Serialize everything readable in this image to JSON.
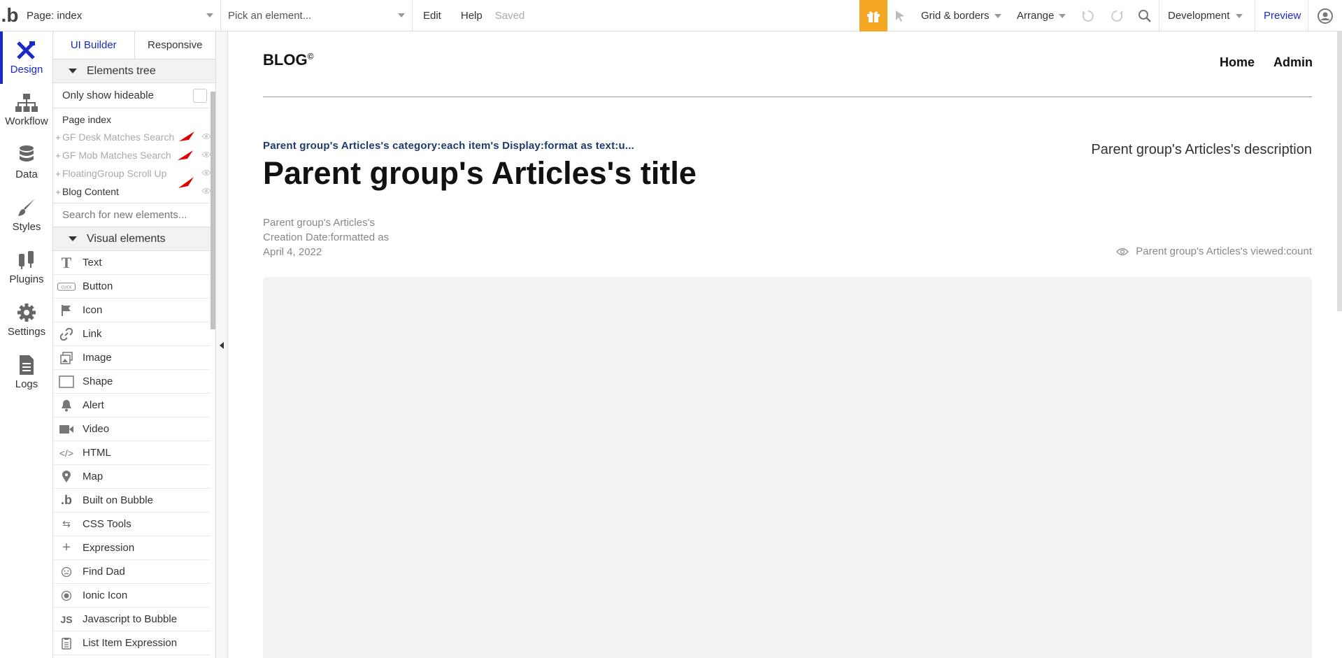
{
  "topbar": {
    "page_select": "Page: index",
    "element_picker": "Pick an element...",
    "edit": "Edit",
    "help": "Help",
    "saved": "Saved",
    "grid": "Grid & borders",
    "arrange": "Arrange",
    "environment": "Development",
    "preview": "Preview"
  },
  "rail": {
    "items": [
      {
        "label": "Design",
        "icon": "design-icon"
      },
      {
        "label": "Workflow",
        "icon": "workflow-icon"
      },
      {
        "label": "Data",
        "icon": "database-icon"
      },
      {
        "label": "Styles",
        "icon": "brush-icon"
      },
      {
        "label": "Plugins",
        "icon": "plug-icon"
      },
      {
        "label": "Settings",
        "icon": "gear-icon"
      },
      {
        "label": "Logs",
        "icon": "document-icon"
      }
    ]
  },
  "panel": {
    "tab_ui": "UI Builder",
    "tab_responsive": "Responsive",
    "elements_tree": "Elements tree",
    "only_show_hideable": "Only show hideable",
    "page_root": "Page index",
    "tree": [
      "GF Desk Matches Search",
      "GF Mob Matches Search",
      "FloatingGroup Scroll Up",
      "Blog Content"
    ],
    "search_placeholder": "Search for new elements...",
    "visual_elements": "Visual elements",
    "visual": [
      "Text",
      "Button",
      "Icon",
      "Link",
      "Image",
      "Shape",
      "Alert",
      "Video",
      "HTML",
      "Map",
      "Built on Bubble",
      "CSS Tools",
      "Expression",
      "Find Dad",
      "Ionic Icon",
      "Javascript to Bubble",
      "List Item Expression"
    ]
  },
  "canvas": {
    "logo": "BLOG",
    "logo_sup": "©",
    "nav_home": "Home",
    "nav_admin": "Admin",
    "category": "Parent group's Articles's category:each item's Display:format as text:u...",
    "title": "Parent group's Articles's title",
    "description": "Parent group's Articles's description",
    "date_line1": "Parent group's Articles's",
    "date_line2": "Creation Date:formatted as",
    "date_line3": "April 4, 2022",
    "views": "Parent group's Articles's viewed:count"
  },
  "colors": {
    "accent": "#1a29c8",
    "gift": "#f5a623",
    "category_text": "#1f3a6e",
    "arrow": "#e00000"
  }
}
